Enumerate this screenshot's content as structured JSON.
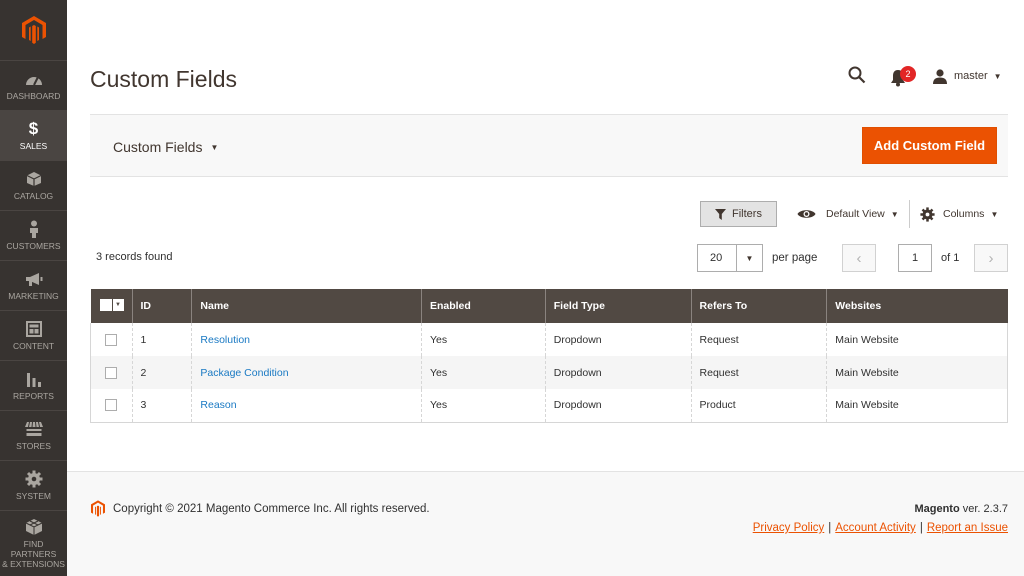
{
  "sidebar": {
    "items": [
      {
        "label": "Dashboard",
        "icon": "dashboard-icon"
      },
      {
        "label": "Sales",
        "icon": "dollar-icon",
        "active": true
      },
      {
        "label": "Catalog",
        "icon": "box-icon"
      },
      {
        "label": "Customers",
        "icon": "person-icon"
      },
      {
        "label": "Marketing",
        "icon": "megaphone-icon"
      },
      {
        "label": "Content",
        "icon": "layout-icon"
      },
      {
        "label": "Reports",
        "icon": "bar-chart-icon"
      },
      {
        "label": "Stores",
        "icon": "store-icon"
      },
      {
        "label": "System",
        "icon": "gear-icon"
      },
      {
        "label_line1": "Find Partners",
        "label_line2": "& Extensions",
        "icon": "cube-icon"
      }
    ]
  },
  "header": {
    "title": "Custom Fields",
    "notifications_count": "2",
    "username": "master"
  },
  "toolbar": {
    "switcher_label": "Custom Fields",
    "add_button": "Add Custom Field"
  },
  "grid_controls": {
    "filters": "Filters",
    "view": "Default View",
    "columns": "Columns",
    "records_found": "3 records found",
    "per_page_value": "20",
    "per_page_label": "per page",
    "page_current": "1",
    "page_of": "of 1"
  },
  "table": {
    "headers": [
      "ID",
      "Name",
      "Enabled",
      "Field Type",
      "Refers To",
      "Websites"
    ],
    "rows": [
      {
        "id": "1",
        "name": "Resolution",
        "enabled": "Yes",
        "field_type": "Dropdown",
        "refers_to": "Request",
        "websites": "Main Website"
      },
      {
        "id": "2",
        "name": "Package Condition",
        "enabled": "Yes",
        "field_type": "Dropdown",
        "refers_to": "Request",
        "websites": "Main Website"
      },
      {
        "id": "3",
        "name": "Reason",
        "enabled": "Yes",
        "field_type": "Dropdown",
        "refers_to": "Product",
        "websites": "Main Website"
      }
    ]
  },
  "footer": {
    "copyright": "Copyright © 2021 Magento Commerce Inc. All rights reserved.",
    "brand": "Magento",
    "version": " ver. 2.3.7",
    "links": [
      "Privacy Policy",
      "Account Activity",
      "Report an Issue"
    ]
  },
  "colors": {
    "accent": "#eb5202",
    "sidebar_bg": "#373330",
    "table_header_bg": "#514943",
    "link": "#1979c3"
  }
}
